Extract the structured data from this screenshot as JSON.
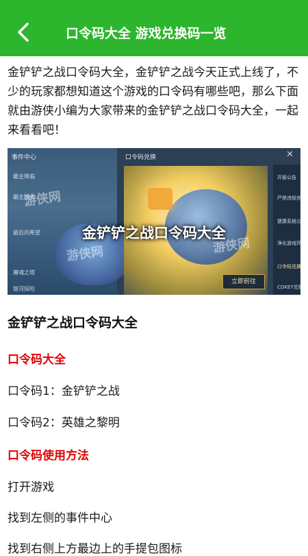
{
  "header": {
    "title": "口令码大全 游戏兑换码一览",
    "back_icon": "chevron-left-icon",
    "bar_color": "#2db52d"
  },
  "article": {
    "intro": "金铲铲之战口令码大全，金铲铲之战今天正式上线了，不少的玩家都想知道这个游戏的口令码有哪些吧，那么下面就由游侠小编为大家带来的金铲铲之战口令码大全，一起来看看吧！",
    "image": {
      "overlay_title": "金铲铲之战口令码大全",
      "popup_title": "口令码兑换",
      "left_panel_title": "事件中心",
      "left_menu": [
        "霸主降临",
        "霸主提示",
        "最后的希望",
        "魔魂之塔",
        "银河探险"
      ],
      "right_menu": [
        "开服公告",
        "严禁违规充值",
        "健康系统公告",
        "净化游戏环境",
        "口令码兑换",
        "CDKEY兑换"
      ],
      "go_button": "立即前往",
      "watermark": "游侠网"
    },
    "section_title": "金铲铲之战口令码大全",
    "subsection1": "口令码大全",
    "codes": [
      "口令码1：金铲铲之战",
      "口令码2：英雄之黎明"
    ],
    "subsection2": "口令码使用方法",
    "steps": [
      "打开游戏",
      "找到左侧的事件中心",
      "找到右侧上方最边上的手提包图标"
    ],
    "accent_color": "#e00000"
  }
}
